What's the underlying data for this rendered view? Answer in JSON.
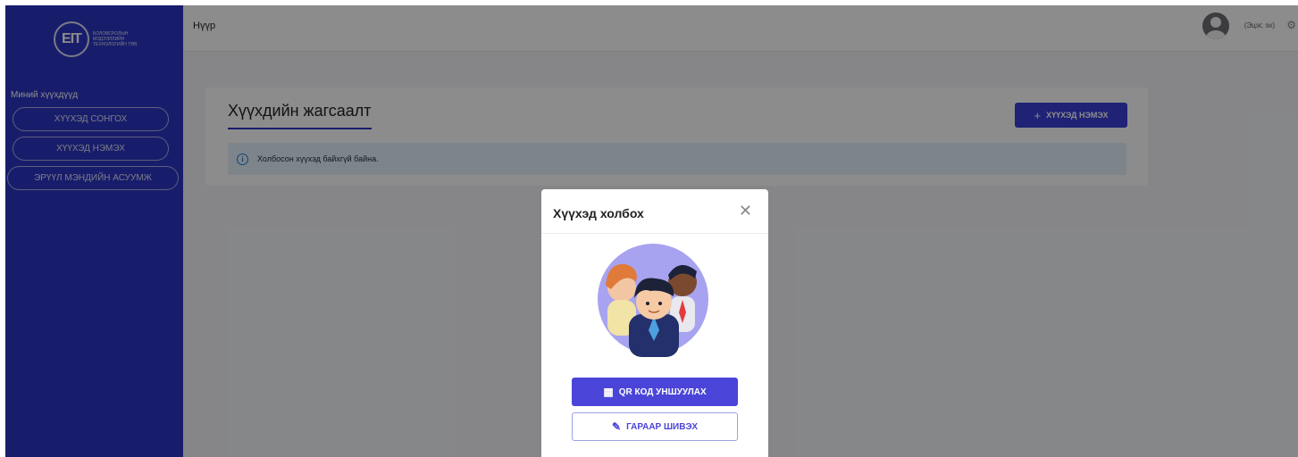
{
  "sidebar": {
    "logo_mark": "EIT",
    "logo_text": "БОЛОВСРОЛЫН МЭДЭЭЛЛИЙН ТЕХНОЛОГИЙН ТӨВ",
    "heading": "Миний хүүхдүүд",
    "items": [
      {
        "label": "ХҮҮХЭД СОНГОХ"
      },
      {
        "label": "ХҮҮХЭД НЭМЭХ"
      },
      {
        "label": "ЭРҮҮЛ МЭНДИЙН АСУУМЖ"
      }
    ]
  },
  "header": {
    "title": "Нүүр",
    "user_role": "(Эцэг, эх)"
  },
  "main": {
    "title": "Хүүхдийн жагсаалт",
    "add_button": "ХҮҮХЭД НЭМЭХ",
    "alert_text": "Холбосон хүүхэд байхгүй байна."
  },
  "modal": {
    "title": "Хүүхэд холбох",
    "qr_button": "QR КОД УНШУУЛАХ",
    "manual_button": "ГАРААР ШИВЭХ"
  },
  "colors": {
    "sidebar": "#2d35c4",
    "primary_button": "#4a45d8",
    "alert_bg": "#e6f2fb"
  },
  "icons": [
    "close-icon",
    "info-icon",
    "plus-icon",
    "qr-code-icon",
    "pencil-icon",
    "user-avatar-icon",
    "children-illustration"
  ]
}
